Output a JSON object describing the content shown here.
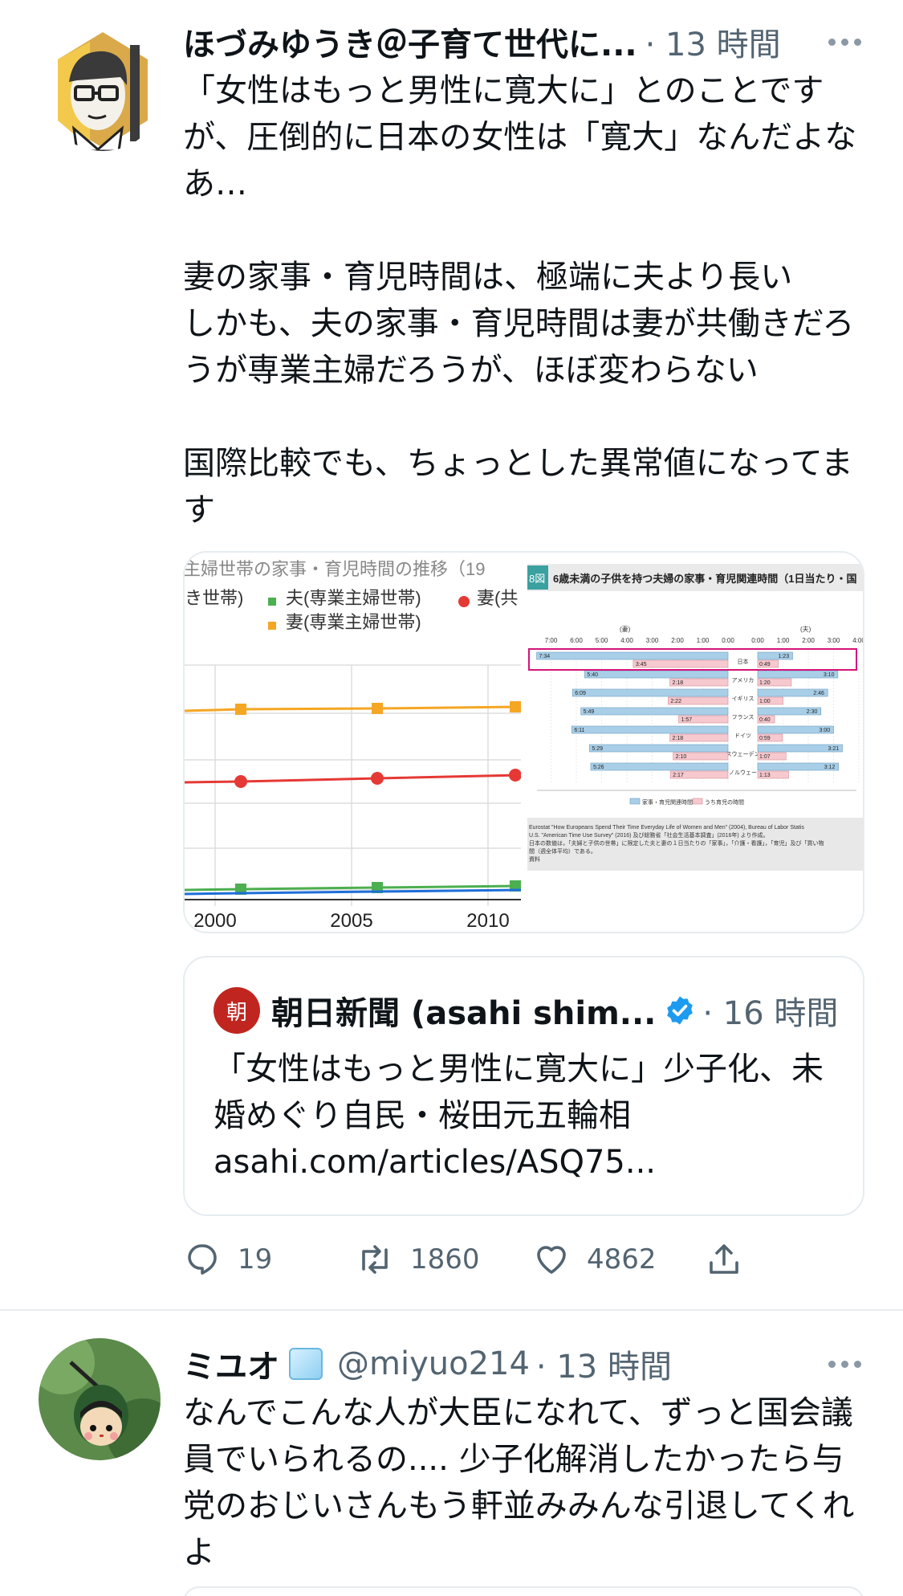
{
  "tweet1": {
    "display_name": "ほづみゆうき＠子育て世代に...",
    "time": "· 13 時間",
    "more_icon": "more-horizontal-icon",
    "text": "「女性はもっと男性に寛大に」とのことですが、圧倒的に日本の女性は「寛大」なんだよなあ…\n\n妻の家事・育児時間は、極端に夫より長い\nしかも、夫の家事・育児時間は妻が共働きだろうが専業主婦だろうが、ほぼ変わらない\n\n国際比較でも、ちょっとした異常値になってます",
    "left_image": {
      "title": "主婦世帯の家事・育児時間の推移（19",
      "legend": [
        {
          "label": "き世帯)",
          "color": ""
        },
        {
          "label": "夫(専業主婦世帯)",
          "color": "#4caf50"
        },
        {
          "label": "妻(共",
          "color": "#e53935"
        },
        {
          "label": "妻(専業主婦世帯)",
          "color": "#f5a623"
        }
      ],
      "x_ticks": [
        "2000",
        "2005",
        "2010"
      ]
    },
    "right_image": {
      "label_num": "8図",
      "title": "6歳未満の子供を持つ夫婦の家事・育児関連時間（1日当たり・国",
      "wife_label": "(妻)",
      "husband_label": "(夫)",
      "scale_left": [
        "7:00",
        "6:00",
        "5:00",
        "4:00",
        "3:00",
        "2:00",
        "1:00",
        "0:00"
      ],
      "scale_right": [
        "0:00",
        "1:00",
        "2:00",
        "3:00",
        "4:00"
      ],
      "rows": [
        {
          "country": "日本",
          "wife_total": "7:34",
          "wife_child": "3:45",
          "husband_total": "1:23",
          "husband_child": "0:49",
          "wife_total_h": 7.57,
          "wife_child_h": 3.75,
          "husband_total_h": 1.38,
          "husband_child_h": 0.82
        },
        {
          "country": "アメリカ",
          "wife_total": "5:40",
          "wife_child": "2:18",
          "husband_total": "3:10",
          "husband_child": "1:20",
          "wife_total_h": 5.67,
          "wife_child_h": 2.3,
          "husband_total_h": 3.17,
          "husband_child_h": 1.33
        },
        {
          "country": "イギリス",
          "wife_total": "6:09",
          "wife_child": "2:22",
          "husband_total": "2:46",
          "husband_child": "1:00",
          "wife_total_h": 6.15,
          "wife_child_h": 2.37,
          "husband_total_h": 2.77,
          "husband_child_h": 1.0
        },
        {
          "country": "フランス",
          "wife_total": "5:49",
          "wife_child": "1:57",
          "husband_total": "2:30",
          "husband_child": "0:40",
          "wife_total_h": 5.82,
          "wife_child_h": 1.95,
          "husband_total_h": 2.5,
          "husband_child_h": 0.67
        },
        {
          "country": "ドイツ",
          "wife_total": "6:11",
          "wife_child": "2:18",
          "husband_total": "3:00",
          "husband_child": "0:59",
          "wife_total_h": 6.18,
          "wife_child_h": 2.3,
          "husband_total_h": 3.0,
          "husband_child_h": 0.98
        },
        {
          "country": "スウェーデン",
          "wife_total": "5:29",
          "wife_child": "2:10",
          "husband_total": "3:21",
          "husband_child": "1:07",
          "wife_total_h": 5.48,
          "wife_child_h": 2.17,
          "husband_total_h": 3.35,
          "husband_child_h": 1.12
        },
        {
          "country": "ノルウェー",
          "wife_total": "5:26",
          "wife_child": "2:17",
          "husband_total": "3:12",
          "husband_child": "1:13",
          "wife_total_h": 5.43,
          "wife_child_h": 2.28,
          "husband_total_h": 3.2,
          "husband_child_h": 1.22
        }
      ],
      "legend": [
        "家事・育児関連時間",
        "うち育児の時間"
      ],
      "notes": [
        "Eurostat \"How Europeans Spend Their Time Everyday Life of Women and Men\" (2004), Bureau of Labor Statis",
        "U.S. \"American Time Use Survey\" (2016) 及び総務省「社会生活基本調査」(2016年) より作成。",
        "日本の数値は，「夫婦と子供の世帯」に限定した夫と妻の１日当たりの「家事」，「介護・看護」，「育児」及び「買い物",
        "間（週全体平均）である。",
        "資料"
      ]
    },
    "quote": {
      "avatar_text": "朝",
      "display_name": "朝日新聞 (asahi shim...",
      "verified_icon": "verified-badge-icon",
      "time": "· 16 時間",
      "text": "「女性はもっと男性に寛大に」少子化、未婚めぐり自民・桜田元五輪相\nasahi.com/articles/ASQ75..."
    },
    "actions": {
      "reply_icon": "reply-icon",
      "reply_count": "19",
      "retweet_icon": "retweet-icon",
      "retweet_count": "1860",
      "like_icon": "heart-icon",
      "like_count": "4862",
      "share_icon": "share-icon"
    }
  },
  "tweet2": {
    "display_name": "ミユオ",
    "emoji_icon": "ice-cube-icon",
    "handle": "@miyuo214",
    "time": "· 13 時間",
    "text": "なんでこんな人が大臣になれて、ずっと国会議員でいられるの.... 少子化解消したかったら与党のおじいさんもう軒並みみんな引退してくれよ"
  },
  "colors": {
    "text": "#0f1419",
    "muted": "#536471",
    "border": "#e6ecf0",
    "verified": "#1d9bf0",
    "asahi_red": "#c0261f"
  }
}
